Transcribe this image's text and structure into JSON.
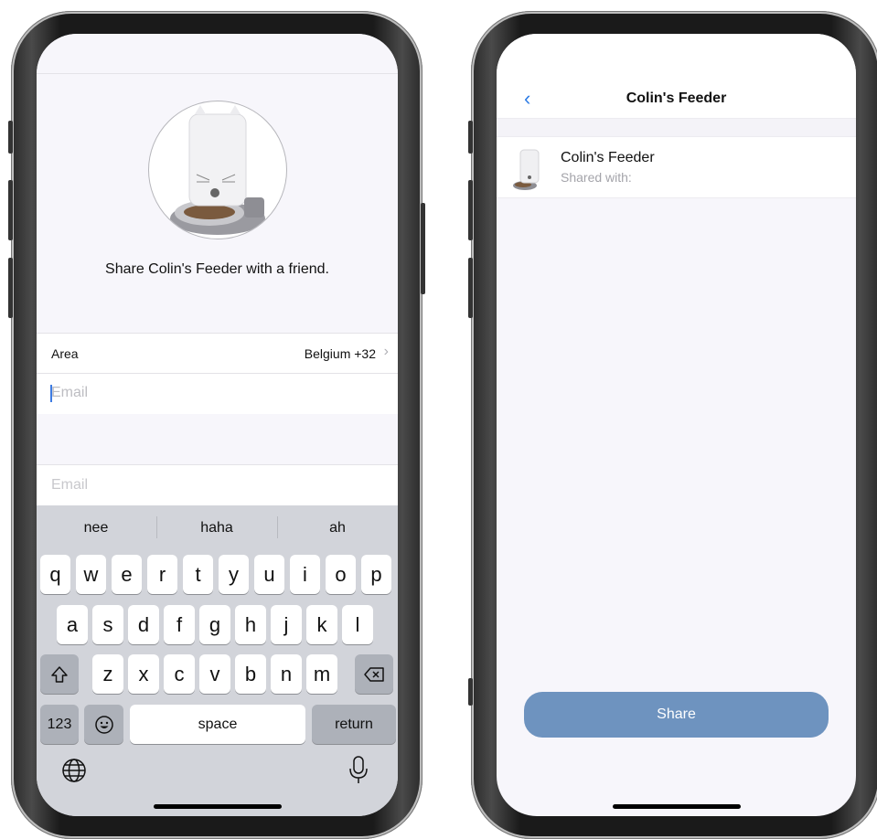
{
  "left_screen": {
    "share_message": "Share Colin's Feeder with a friend.",
    "area_label": "Area",
    "area_value": "Belgium +32",
    "email_placeholder": "Email",
    "email2_placeholder": "Email",
    "suggestions": [
      "nee",
      "haha",
      "ah"
    ],
    "keys_row1": [
      "q",
      "w",
      "e",
      "r",
      "t",
      "y",
      "u",
      "i",
      "o",
      "p"
    ],
    "keys_row2": [
      "a",
      "s",
      "d",
      "f",
      "g",
      "h",
      "j",
      "k",
      "l"
    ],
    "keys_row3": [
      "z",
      "x",
      "c",
      "v",
      "b",
      "n",
      "m"
    ],
    "key_numbers": "123",
    "key_space": "space",
    "key_return": "return"
  },
  "right_screen": {
    "nav_title": "Colin's Feeder",
    "device_name": "Colin's Feeder",
    "device_subtitle": "Shared with:",
    "share_button": "Share"
  },
  "colors": {
    "accent": "#2c7be5",
    "share_button": "#6e93bf",
    "keyboard_bg": "#d2d4da"
  }
}
